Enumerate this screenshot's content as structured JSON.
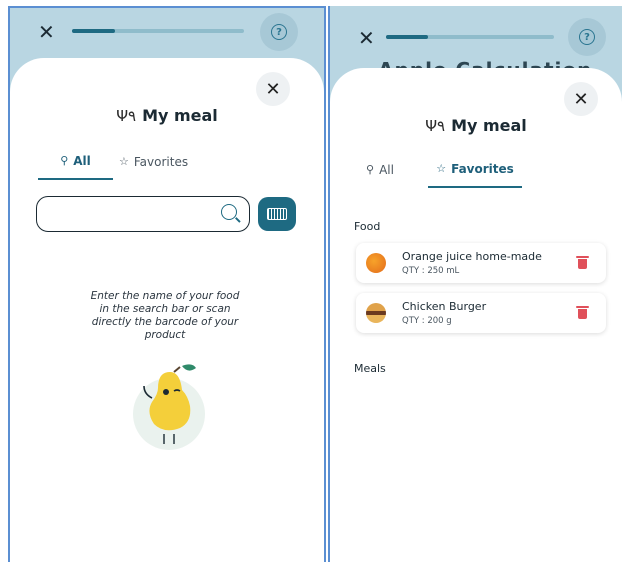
{
  "screens": [
    {
      "sheet_title": "My meal",
      "tabs": [
        {
          "label": "All",
          "icon": "search-icon",
          "active": true
        },
        {
          "label": "Favorites",
          "icon": "star-icon",
          "active": false
        }
      ],
      "search": {
        "value": "",
        "placeholder": ""
      },
      "hint": "Enter the name of your food in the search bar or scan directly the barcode of your product",
      "progress_fraction": 0.25
    },
    {
      "background_title": "Apple Calculation",
      "sheet_title": "My meal",
      "tabs": [
        {
          "label": "All",
          "icon": "search-icon",
          "active": false
        },
        {
          "label": "Favorites",
          "icon": "star-icon",
          "active": true
        }
      ],
      "sections": [
        {
          "label": "Food",
          "items": [
            {
              "name": "Orange juice home-made",
              "qty": "QTY : 250 mL"
            },
            {
              "name": "Chicken Burger",
              "qty": "QTY : 200 g"
            }
          ]
        },
        {
          "label": "Meals",
          "items": []
        }
      ],
      "progress_fraction": 0.25
    }
  ],
  "colors": {
    "primary": "#1e6a82",
    "header_bg": "#b9d6e2",
    "delete": "#e0505a"
  }
}
